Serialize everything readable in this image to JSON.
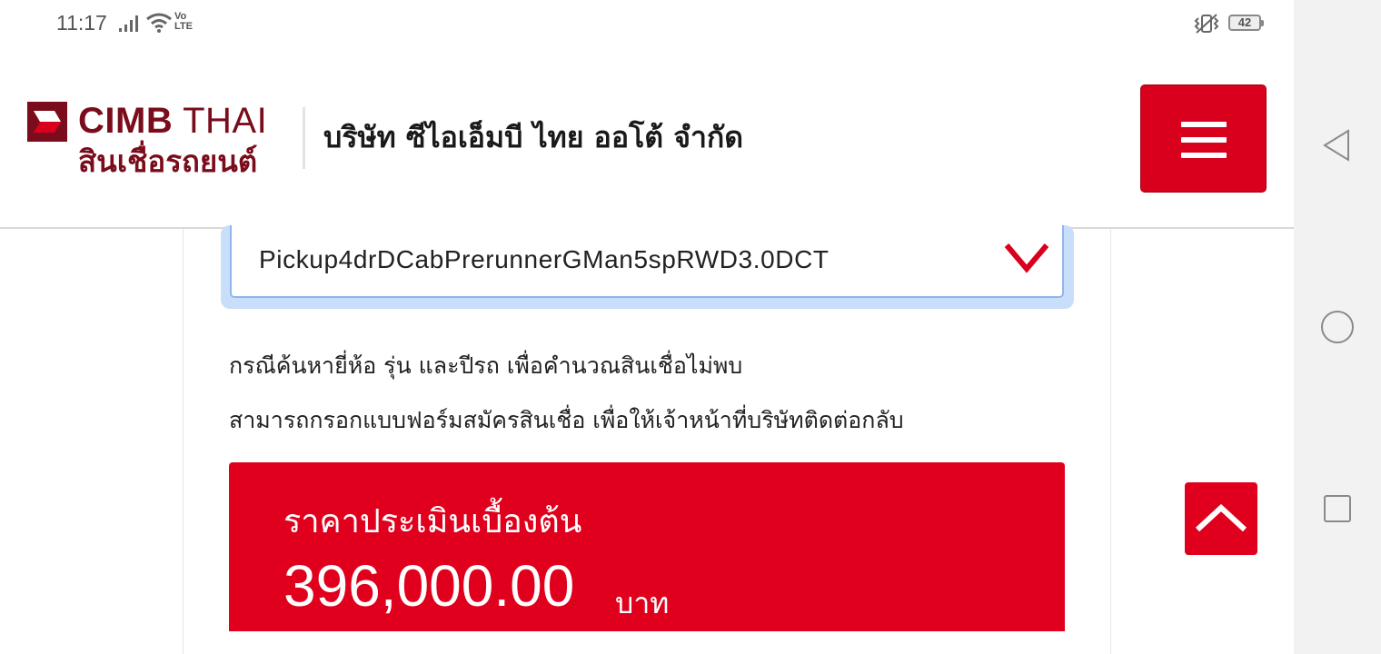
{
  "status_bar": {
    "time": "11:17",
    "network": "Vo\nLTE",
    "battery": "42"
  },
  "header": {
    "logo_brand": "CIMB",
    "logo_country": "THAI",
    "logo_subtitle": "สินเชื่อรถยนต์",
    "company_name": "บริษัท ซีไอเอ็มบี ไทย ออโต้ จำกัด",
    "menu_icon": "hamburger-icon"
  },
  "form": {
    "model_selected": "Pickup4drDCabPrerunnerGMan5spRWD3.0DCT",
    "dropdown_icon": "chevron-down-icon"
  },
  "notes": {
    "line1": "กรณีค้นหายี่ห้อ รุ่น และปีรถ เพื่อคำนวณสินเชื่อไม่พบ",
    "line2": "สามารถกรอกแบบฟอร์มสมัครสินเชื่อ เพื่อให้เจ้าหน้าที่บริษัทติดต่อกลับ"
  },
  "price": {
    "title": "ราคาประเมินเบื้องต้น",
    "value": "396,000.00",
    "unit": "บาท"
  },
  "colors": {
    "brand_red": "#e0001d",
    "brand_maroon": "#7a0c1c",
    "select_focus": "#c8defa"
  }
}
